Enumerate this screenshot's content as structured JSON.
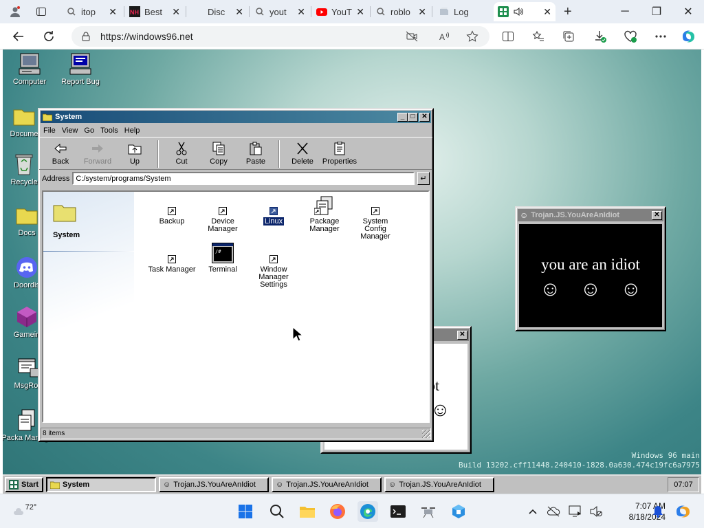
{
  "browser": {
    "tabs": [
      {
        "icon": "search-icon",
        "label": "itop"
      },
      {
        "icon": "nh-icon",
        "label": "Best"
      },
      {
        "icon": "discord-icon",
        "label": "Disc"
      },
      {
        "icon": "search-icon",
        "label": "yout"
      },
      {
        "icon": "youtube-icon",
        "label": "YouT"
      },
      {
        "icon": "search-icon",
        "label": "roblo"
      },
      {
        "icon": "page-icon",
        "label": "Log"
      },
      {
        "icon": "windows96-icon",
        "label": ""
      }
    ],
    "new_tab": "+",
    "url": "https://windows96.net",
    "colors": {
      "accent": "#0b57d0",
      "chrome": "#e9eef5"
    }
  },
  "desktop": {
    "icons": [
      {
        "label": "Computer"
      },
      {
        "label": "Report Bug"
      },
      {
        "label": "Docume"
      },
      {
        "label": "Recycle"
      },
      {
        "label": "Docs"
      },
      {
        "label": "Doordis"
      },
      {
        "label": "Gamein"
      },
      {
        "label": "MsgRoo"
      },
      {
        "label": "Packa Manager"
      }
    ],
    "build_line1": "Windows 96 main",
    "build_line2": "Build 13202.cff11448.240410-1828.0a630.474c19fc6a7975"
  },
  "system_window": {
    "title": "System",
    "menu": [
      "File",
      "View",
      "Go",
      "Tools",
      "Help"
    ],
    "toolbar": {
      "back": "Back",
      "forward": "Forward",
      "up": "Up",
      "cut": "Cut",
      "copy": "Copy",
      "paste": "Paste",
      "delete": "Delete",
      "properties": "Properties"
    },
    "address_label": "Address",
    "address_value": "C:/system/programs/System",
    "side_title": "System",
    "items": [
      {
        "label": "Backup"
      },
      {
        "label": "Device Manager"
      },
      {
        "label": "Linux"
      },
      {
        "label": "Package Manager"
      },
      {
        "label": "System Config Manager"
      },
      {
        "label": "Task Manager"
      },
      {
        "label": "Terminal"
      },
      {
        "label": "Window Manager Settings"
      }
    ],
    "status": "8 items"
  },
  "idiot_window": {
    "title": "Trojan.JS.YouAreAnIdiot",
    "message": "you are an idiot",
    "faces": [
      "☺",
      "☺",
      "☺"
    ],
    "back_partial_text": "ot"
  },
  "w96_taskbar": {
    "start": "Start",
    "tasks": [
      {
        "label": "System"
      },
      {
        "label": "Trojan.JS.YouAreAnIdiot"
      },
      {
        "label": "Trojan.JS.YouAreAnIdiot"
      },
      {
        "label": "Trojan.JS.YouAreAnIdiot"
      }
    ],
    "clock": "07:07"
  },
  "os_taskbar": {
    "weather_temp": "72°",
    "time": "7:07 AM",
    "date": "8/18/2024"
  }
}
